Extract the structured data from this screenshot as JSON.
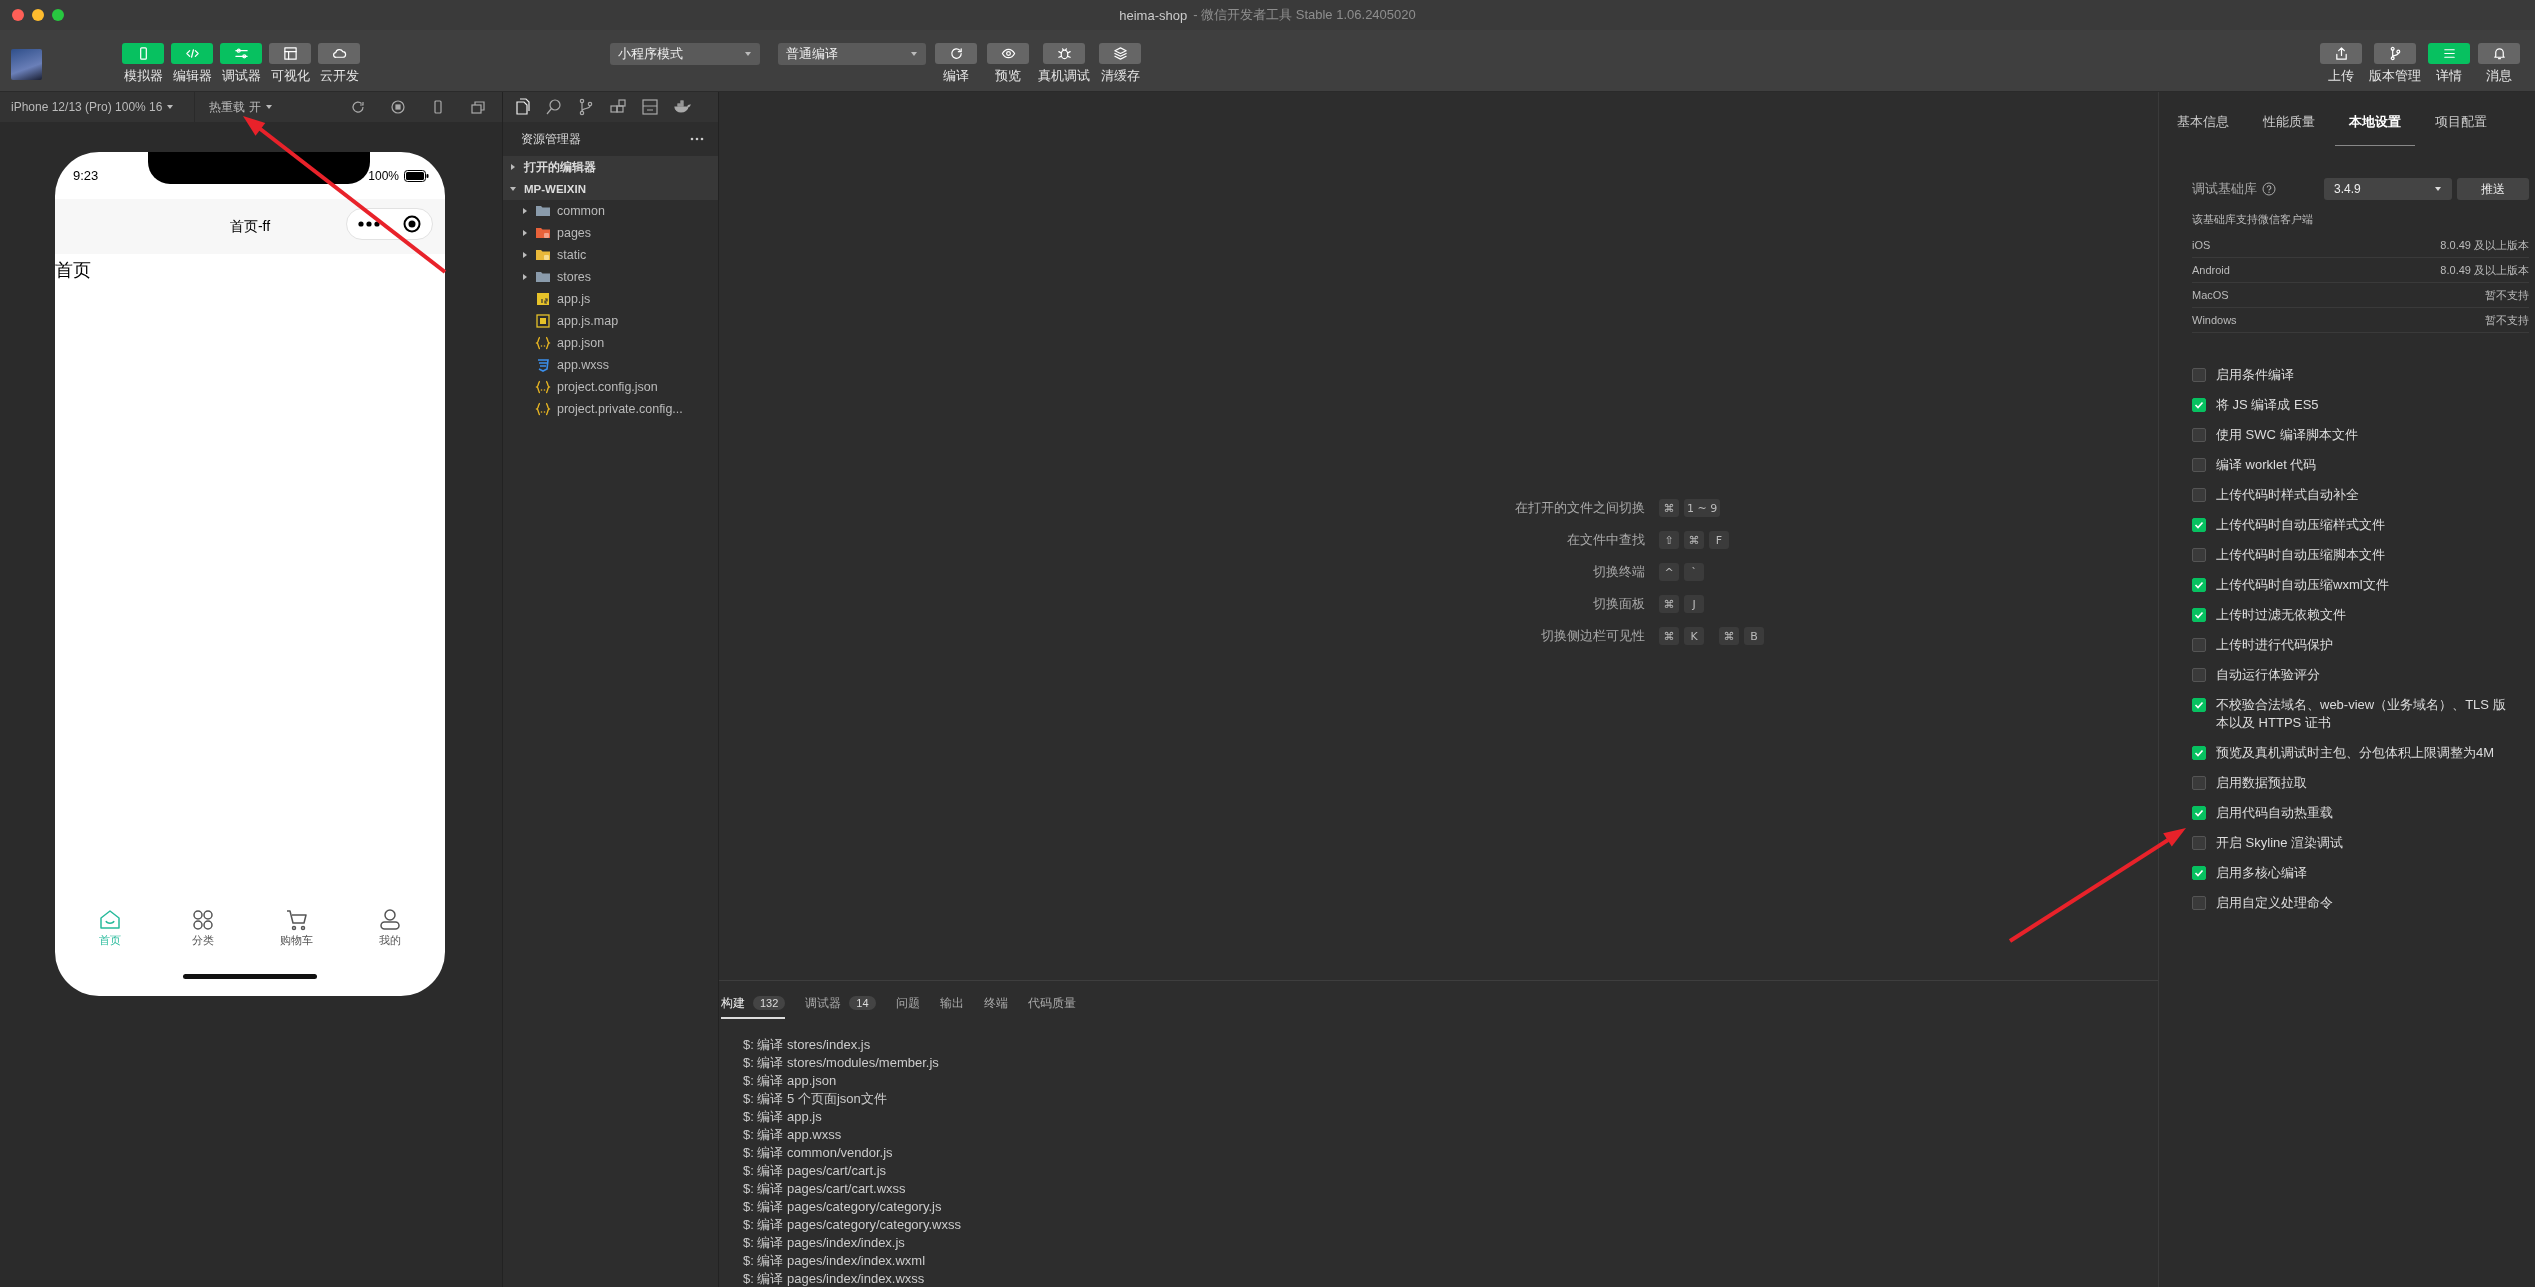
{
  "window": {
    "title": "heima-shop",
    "subtitle": "- 微信开发者工具 Stable 1.06.2405020"
  },
  "toolbar": {
    "left_buttons": [
      {
        "label": "模拟器",
        "kind": "simulator",
        "on": true
      },
      {
        "label": "编辑器",
        "kind": "editor",
        "on": true
      },
      {
        "label": "调试器",
        "kind": "debugger",
        "on": true
      },
      {
        "label": "可视化",
        "kind": "visual",
        "on": false
      },
      {
        "label": "云开发",
        "kind": "cloud",
        "on": false
      }
    ],
    "mode_select": "小程序模式",
    "compile_select": "普通编译",
    "mid_buttons": [
      {
        "label": "编译",
        "kind": "compile"
      },
      {
        "label": "预览",
        "kind": "preview"
      },
      {
        "label": "真机调试",
        "kind": "device"
      },
      {
        "label": "清缓存",
        "kind": "cache"
      }
    ],
    "right_buttons": [
      {
        "label": "上传",
        "kind": "upload",
        "on": false
      },
      {
        "label": "版本管理",
        "kind": "version",
        "on": false
      },
      {
        "label": "详情",
        "kind": "details",
        "on": true
      },
      {
        "label": "消息",
        "kind": "messages",
        "on": false
      }
    ]
  },
  "simulator": {
    "device": "iPhone 12/13 (Pro) 100% 16",
    "hot_reload": "热重载 开",
    "phone": {
      "time": "9:23",
      "battery": "100%",
      "nav_title": "首页-ff",
      "body": "首页",
      "tabs": [
        {
          "label": "首页",
          "kind": "home",
          "selected": true
        },
        {
          "label": "分类",
          "kind": "category",
          "selected": false
        },
        {
          "label": "购物车",
          "kind": "cart",
          "selected": false
        },
        {
          "label": "我的",
          "kind": "profile",
          "selected": false
        }
      ]
    }
  },
  "explorer": {
    "title": "资源管理器",
    "sections": [
      {
        "label": "打开的编辑器",
        "expanded": false
      },
      {
        "label": "MP-WEIXIN",
        "expanded": true,
        "children": [
          {
            "name": "common",
            "kind": "folder",
            "expanded": false
          },
          {
            "name": "pages",
            "kind": "pages-folder",
            "expanded": false
          },
          {
            "name": "static",
            "kind": "static-folder",
            "expanded": false
          },
          {
            "name": "stores",
            "kind": "folder",
            "expanded": false
          },
          {
            "name": "app.js",
            "kind": "js"
          },
          {
            "name": "app.js.map",
            "kind": "map"
          },
          {
            "name": "app.json",
            "kind": "json"
          },
          {
            "name": "app.wxss",
            "kind": "wxss"
          },
          {
            "name": "project.config.json",
            "kind": "json"
          },
          {
            "name": "project.private.config...",
            "kind": "json"
          }
        ]
      }
    ]
  },
  "shortcuts": [
    {
      "label": "在打开的文件之间切换",
      "chords": [
        [
          "⌘",
          "1 ~ 9"
        ]
      ]
    },
    {
      "label": "在文件中查找",
      "chords": [
        [
          "⇧",
          "⌘",
          "F"
        ]
      ]
    },
    {
      "label": "切换终端",
      "chords": [
        [
          "^",
          "`"
        ]
      ]
    },
    {
      "label": "切换面板",
      "chords": [
        [
          "⌘",
          "J"
        ]
      ]
    },
    {
      "label": "切换侧边栏可见性",
      "chords": [
        [
          "⌘",
          "K"
        ],
        [
          "⌘",
          "B"
        ]
      ]
    }
  ],
  "console": {
    "tabs": [
      {
        "label": "构建",
        "count": "132",
        "selected": true
      },
      {
        "label": "调试器",
        "count": "14",
        "selected": false
      },
      {
        "label": "问题",
        "selected": false
      },
      {
        "label": "输出",
        "selected": false
      },
      {
        "label": "终端",
        "selected": false
      },
      {
        "label": "代码质量",
        "selected": false
      }
    ],
    "lines": [
      "$: 编译 stores/index.js",
      "$: 编译 stores/modules/member.js",
      "$: 编译 app.json",
      "$: 编译 5 个页面json文件",
      "$: 编译 app.js",
      "$: 编译 app.wxss",
      "$: 编译 common/vendor.js",
      "$: 编译 pages/cart/cart.js",
      "$: 编译 pages/cart/cart.wxss",
      "$: 编译 pages/category/category.js",
      "$: 编译 pages/category/category.wxss",
      "$: 编译 pages/index/index.js",
      "$: 编译 pages/index/index.wxml",
      "$: 编译 pages/index/index.wxss"
    ]
  },
  "details": {
    "tabs": [
      {
        "label": "基本信息",
        "selected": false
      },
      {
        "label": "性能质量",
        "selected": false
      },
      {
        "label": "本地设置",
        "selected": true
      },
      {
        "label": "项目配置",
        "selected": false
      }
    ],
    "base_lib": {
      "label": "调试基础库",
      "version": "3.4.9",
      "action": "推送"
    },
    "support": {
      "title": "该基础库支持微信客户端",
      "rows": [
        {
          "platform": "iOS",
          "requirement": "8.0.49 及以上版本"
        },
        {
          "platform": "Android",
          "requirement": "8.0.49 及以上版本"
        },
        {
          "platform": "MacOS",
          "requirement": "暂不支持"
        },
        {
          "platform": "Windows",
          "requirement": "暂不支持"
        }
      ]
    },
    "options": [
      {
        "label": "启用条件编译",
        "checked": false
      },
      {
        "label": "将 JS 编译成 ES5",
        "checked": true
      },
      {
        "label": "使用 SWC 编译脚本文件",
        "checked": false
      },
      {
        "label": "编译 worklet 代码",
        "checked": false
      },
      {
        "label": "上传代码时样式自动补全",
        "checked": false
      },
      {
        "label": "上传代码时自动压缩样式文件",
        "checked": true
      },
      {
        "label": "上传代码时自动压缩脚本文件",
        "checked": false
      },
      {
        "label": "上传代码时自动压缩wxml文件",
        "checked": true
      },
      {
        "label": "上传时过滤无依赖文件",
        "checked": true
      },
      {
        "label": "上传时进行代码保护",
        "checked": false
      },
      {
        "label": "自动运行体验评分",
        "checked": false
      },
      {
        "label": "不校验合法域名、web-view（业务域名）、TLS 版本以及 HTTPS 证书",
        "checked": true
      },
      {
        "label": "预览及真机调试时主包、分包体积上限调整为4M",
        "checked": true
      },
      {
        "label": "启用数据预拉取",
        "checked": false
      },
      {
        "label": "启用代码自动热重载",
        "checked": true
      },
      {
        "label": "开启 Skyline 渲染调试",
        "checked": false
      },
      {
        "label": "启用多核心编译",
        "checked": true
      },
      {
        "label": "启用自定义处理命令",
        "checked": false
      }
    ]
  }
}
